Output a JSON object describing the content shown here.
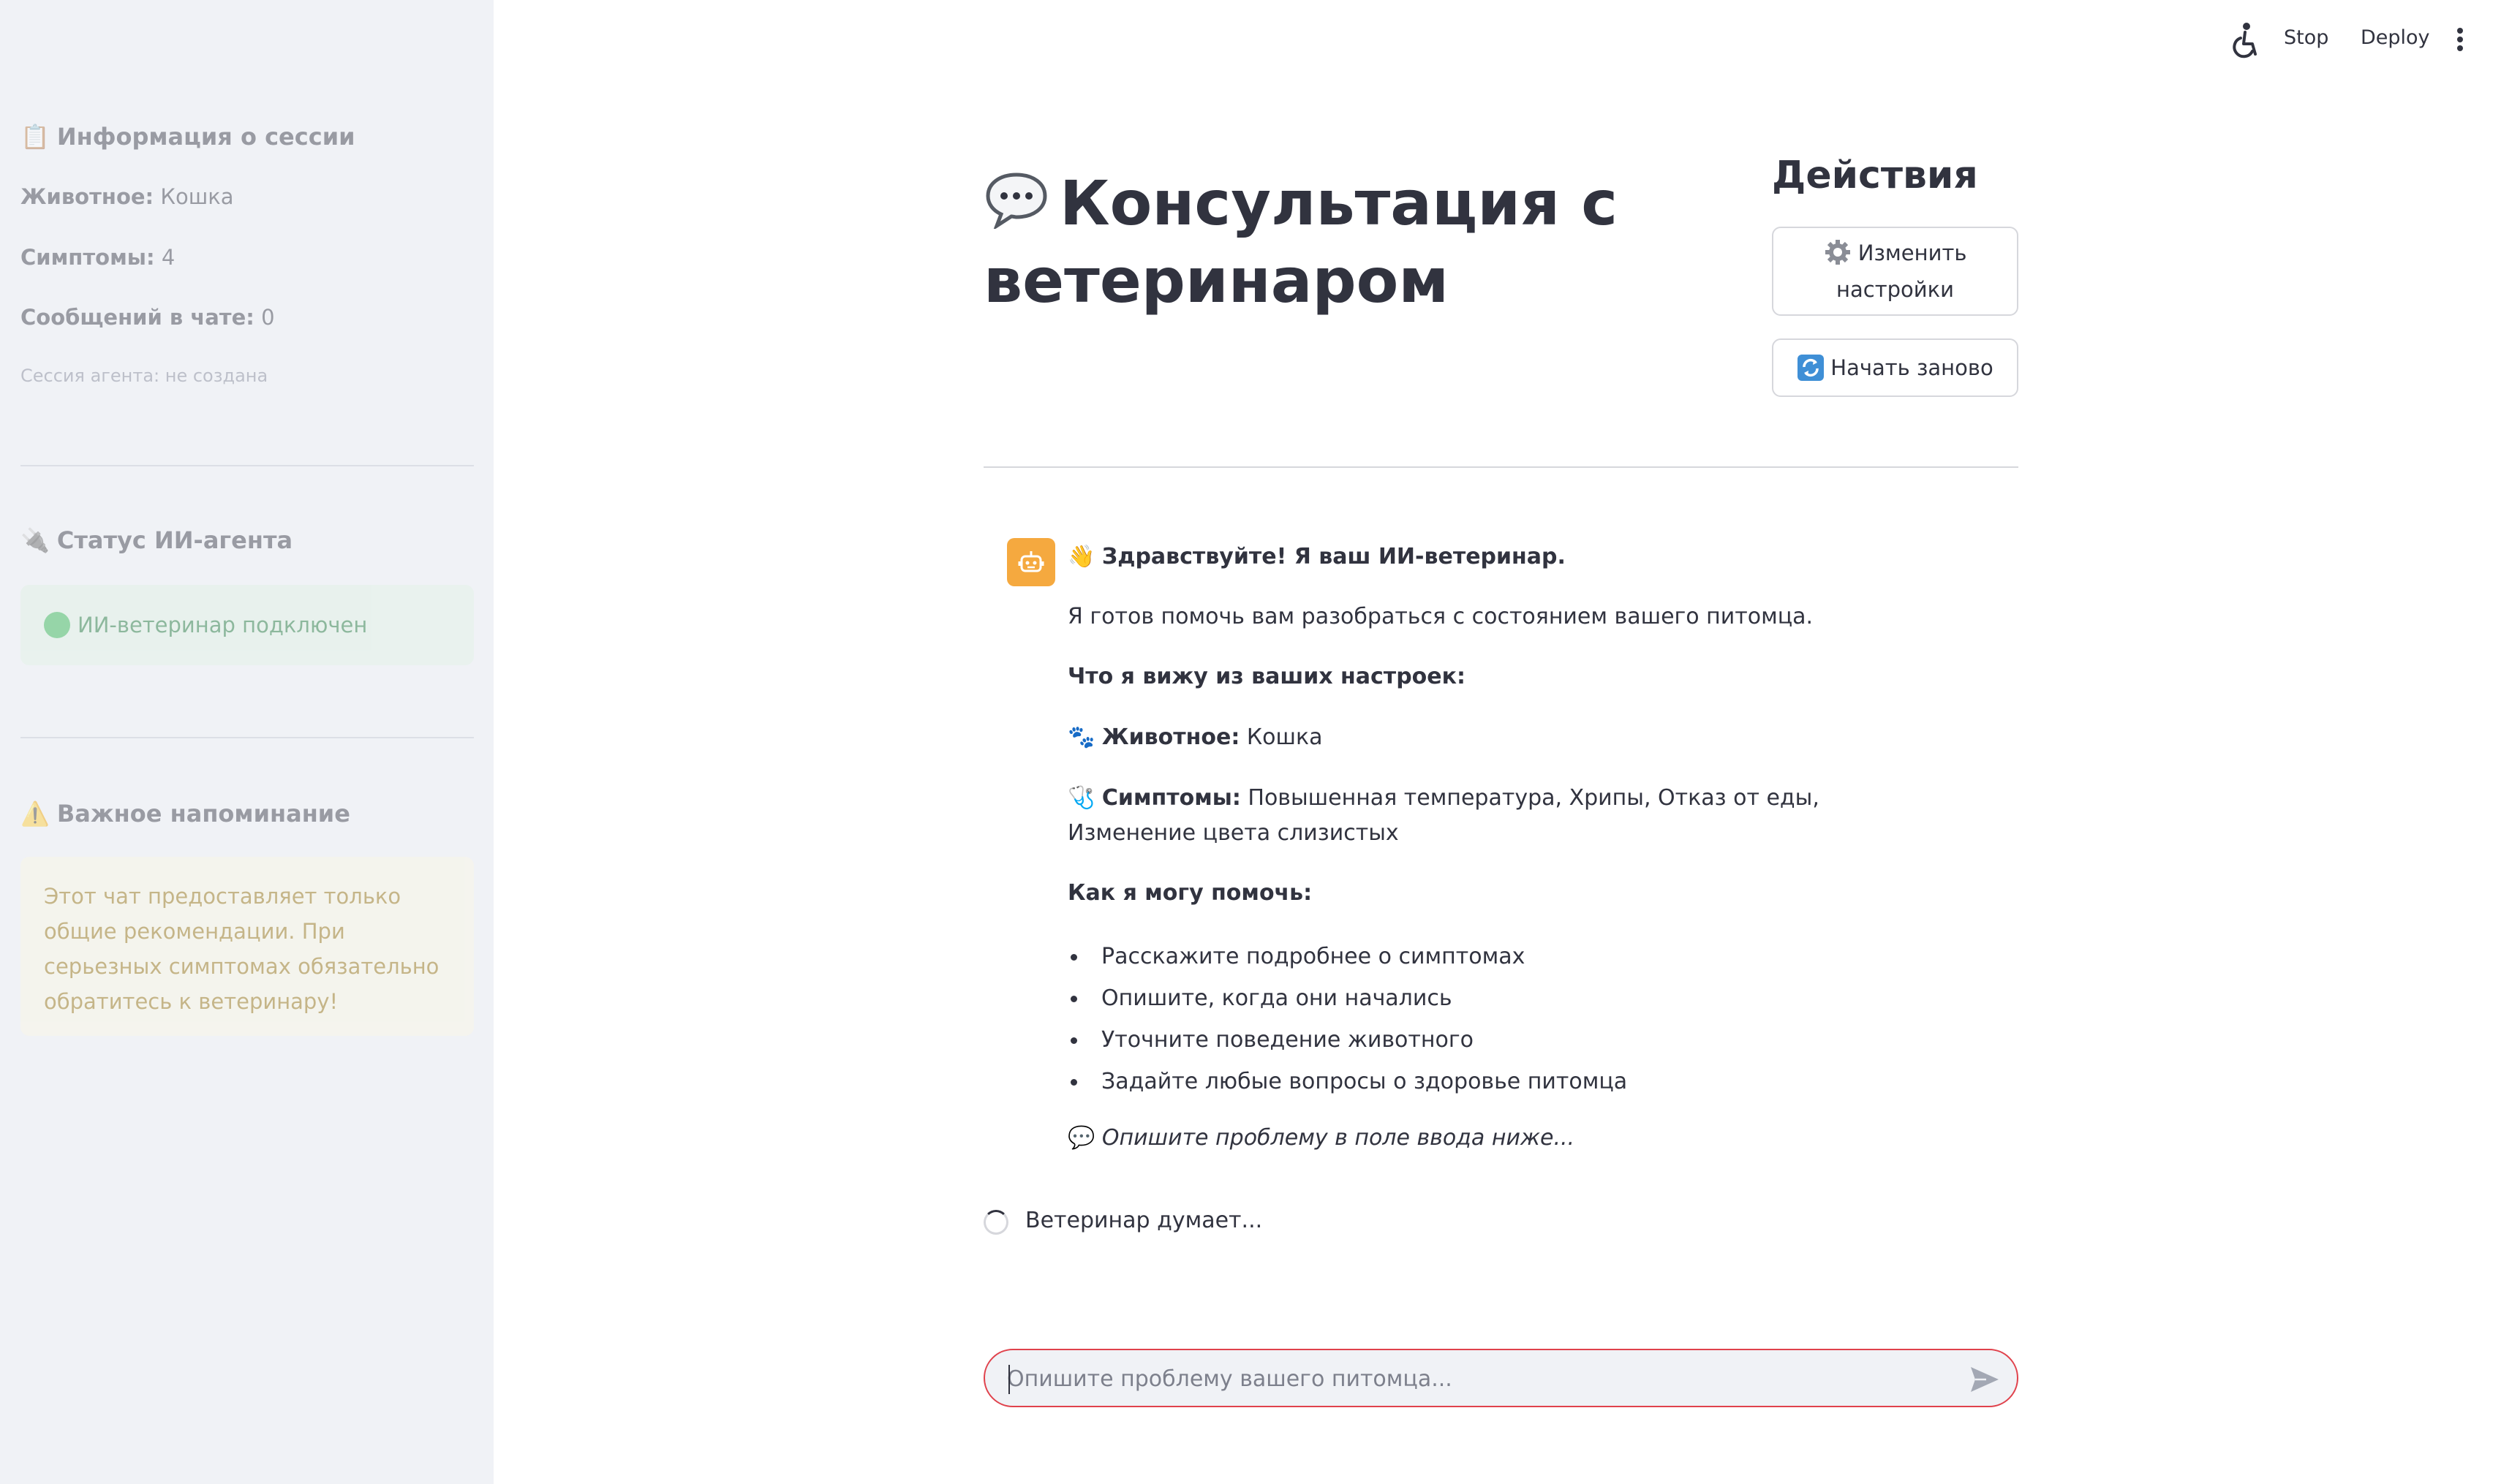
{
  "topbar": {
    "stop_label": "Stop",
    "deploy_label": "Deploy"
  },
  "sidebar": {
    "session": {
      "icon": "📋",
      "heading": "Информация о сессии",
      "animal_label": "Животное:",
      "animal_value": "Кошка",
      "symptoms_label": "Симптомы:",
      "symptoms_value": "4",
      "messages_label": "Сообщений в чате:",
      "messages_value": "0",
      "agent_label": "Сессия агента:",
      "agent_value": "не создана"
    },
    "status": {
      "icon": "🔌",
      "heading": "Статус ИИ-агента",
      "message": "ИИ-ветеринар подключен"
    },
    "reminder": {
      "icon": "⚠️",
      "heading": "Важное напоминание",
      "text": "Этот чат предоставляет только общие рекомендации. При серьезных симптомах обязательно обратитесь к ветеринару!"
    }
  },
  "main": {
    "title_line1": "Консультация с",
    "title_line2": "ветеринаром",
    "actions_heading": "Действия",
    "settings_button_line1": "Изменить",
    "settings_button_line2": "настройки",
    "restart_button": "Начать заново",
    "message": {
      "greeting_icon": "👋",
      "greeting": "Здравствуйте! Я ваш ИИ-ветеринар.",
      "intro": "Я готов помочь вам разобраться с состоянием вашего питомца.",
      "seen_heading": "Что я вижу из ваших настроек:",
      "animal_icon": "🐾",
      "animal_label": "Животное:",
      "animal_value": "Кошка",
      "symptoms_icon": "🩺",
      "symptoms_label": "Симптомы:",
      "symptoms_value": "Повышенная температура, Хрипы, Отказ от еды, Изменение цвета слизистых",
      "help_heading": "Как я могу помочь:",
      "bullets": [
        "Расскажите подробнее о симптомах",
        "Опишите, когда они начались",
        "Уточните поведение животного",
        "Задайте любые вопросы о здоровье питомца"
      ],
      "footer_icon": "💬",
      "footer": "Опишите проблему в поле ввода ниже..."
    },
    "thinking": "Ветеринар думает...",
    "chat_input": {
      "placeholder": "Опишите проблему вашего питомца..."
    }
  },
  "colors": {
    "sidebar_bg": "#f0f2f6",
    "accent_red": "#e0424c",
    "avatar_orange": "#f5a93f",
    "success_green": "#2bb34a"
  }
}
